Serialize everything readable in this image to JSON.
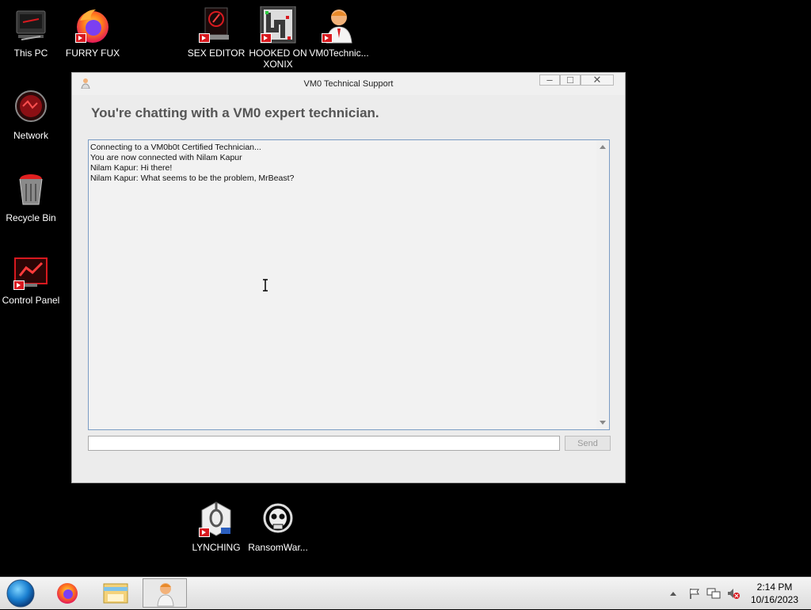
{
  "desktop": {
    "icons": [
      {
        "label": "This PC"
      },
      {
        "label": "FURRY FUX"
      },
      {
        "label": "SEX EDITOR"
      },
      {
        "label": "HOOKED ON XONIX"
      },
      {
        "label": "VM0Technic..."
      },
      {
        "label": "Network"
      },
      {
        "label": "Recycle Bin"
      },
      {
        "label": "Control Panel"
      },
      {
        "label": "LYNCHING"
      },
      {
        "label": "RansomWar..."
      }
    ]
  },
  "window": {
    "title": "VM0 Technical Support",
    "heading": "You're chatting with a VM0 expert technician.",
    "chat_lines": [
      "Connecting to a VM0b0t Certified Technician...",
      "You are now connected with Nilam Kapur",
      "Nilam Kapur: Hi there!",
      "Nilam Kapur: What seems to be the problem, MrBeast?"
    ],
    "input_value": "",
    "send_label": "Send",
    "controls": {
      "minimize": "minimize-icon",
      "maximize": "maximize-icon",
      "close": "close-icon"
    }
  },
  "taskbar": {
    "pinned": [
      "start-orb-icon",
      "firefox-icon",
      "file-explorer-icon",
      "vm0-support-icon"
    ],
    "tray_icons": [
      "show-hidden-icons-icon",
      "flag-icon",
      "network-icon",
      "volume-muted-icon"
    ],
    "time": "2:14 PM",
    "date": "10/16/2023"
  },
  "colors": {
    "desktop_bg": "#000000",
    "window_bg": "#ececec",
    "accent_red": "#d8191f"
  }
}
